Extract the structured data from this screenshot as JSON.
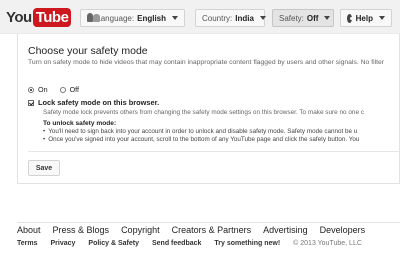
{
  "header": {
    "logo_you": "You",
    "logo_tube": "Tube",
    "language_label": "Language:",
    "language_value": "English",
    "country_label": "Country:",
    "country_value": "India",
    "safety_label": "Safety:",
    "safety_value": "Off",
    "help_label": "Help"
  },
  "panel": {
    "title": "Choose your safety mode",
    "description": "Turn on safety mode to hide videos that may contain inappropriate content flagged by users and other signals. No filter",
    "radio_on": "On",
    "radio_off": "Off",
    "selected": "On",
    "lock_label": "Lock safety mode on this browser.",
    "lock_checked": true,
    "lock_description": "Safety mode lock prevents others from changing the safety mode settings on this browser. To make sure no one c",
    "unlock_title": "To unlock safety mode:",
    "unlock_steps": [
      "You'll need to sign back into your account in order to unlock and disable safety mode. Safety mode cannot be u",
      "Once you've signed into your account, scroll to the bottom of any YouTube page and click the safety button. You"
    ],
    "save_label": "Save"
  },
  "footer": {
    "primary_links": [
      "About",
      "Press & Blogs",
      "Copyright",
      "Creators & Partners",
      "Advertising",
      "Developers"
    ],
    "secondary_links": [
      "Terms",
      "Privacy",
      "Policy & Safety",
      "Send feedback",
      "Try something new!"
    ],
    "copyright": "© 2013 YouTube, LLC"
  }
}
